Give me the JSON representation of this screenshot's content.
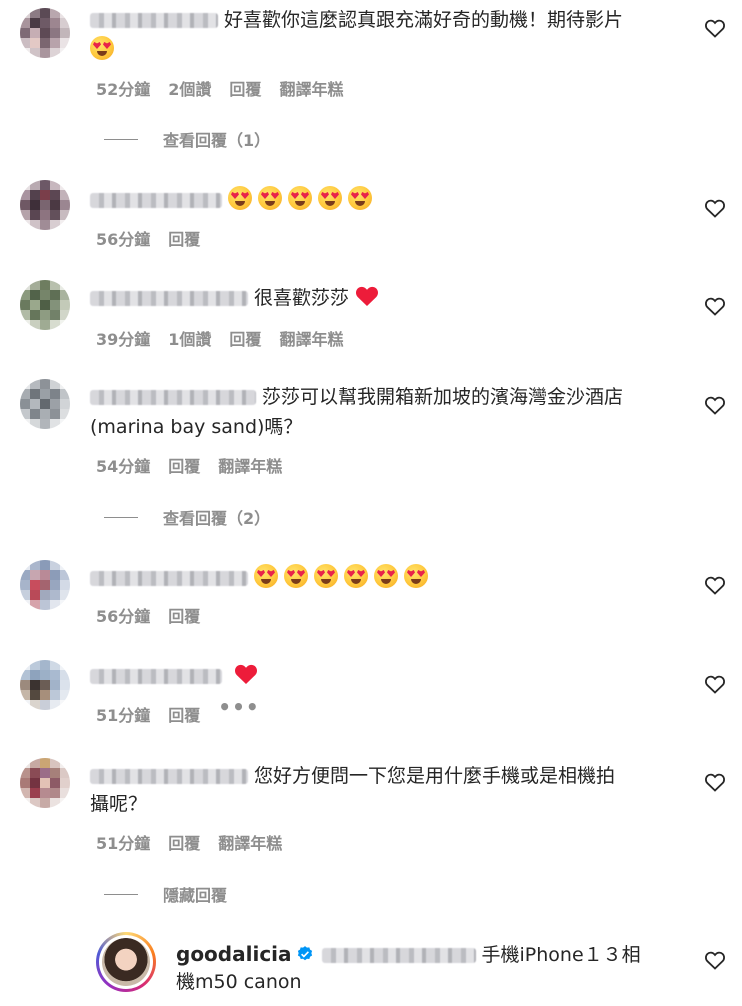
{
  "comments": [
    {
      "text": "好喜歡你這麼認真跟充滿好奇的動機！期待影片",
      "emoji_count": 1,
      "time": "52分鐘",
      "likes": "2個讚",
      "reply": "回覆",
      "translate": "翻譯年糕",
      "view_replies": "查看回覆（1）"
    },
    {
      "text": "",
      "emoji_count": 5,
      "time": "56分鐘",
      "reply": "回覆"
    },
    {
      "text": "很喜歡莎莎",
      "time": "39分鐘",
      "likes": "1個讚",
      "reply": "回覆",
      "translate": "翻譯年糕"
    },
    {
      "text": "莎莎可以幫我開箱新加坡的濱海灣金沙酒店",
      "text2": "(marina bay sand)嗎？",
      "time": "54分鐘",
      "reply": "回覆",
      "translate": "翻譯年糕",
      "view_replies": "查看回覆（2）"
    },
    {
      "text": "",
      "emoji_count": 6,
      "time": "56分鐘",
      "reply": "回覆"
    },
    {
      "text": "",
      "time": "51分鐘",
      "reply": "回覆",
      "more": "•••"
    },
    {
      "text": "您好方便問一下您是用什麼手機或是相機拍",
      "text2": "攝呢？",
      "time": "51分鐘",
      "reply": "回覆",
      "translate": "翻譯年糕",
      "view_replies": "隱藏回覆"
    }
  ],
  "reply": {
    "username": "goodalicia",
    "text": "手機iPhone１３相",
    "text2": "機m50 canon"
  },
  "colors": {
    "meta": "#8e8e8e",
    "heart_red": "#ed1c3a",
    "text": "#262626"
  }
}
